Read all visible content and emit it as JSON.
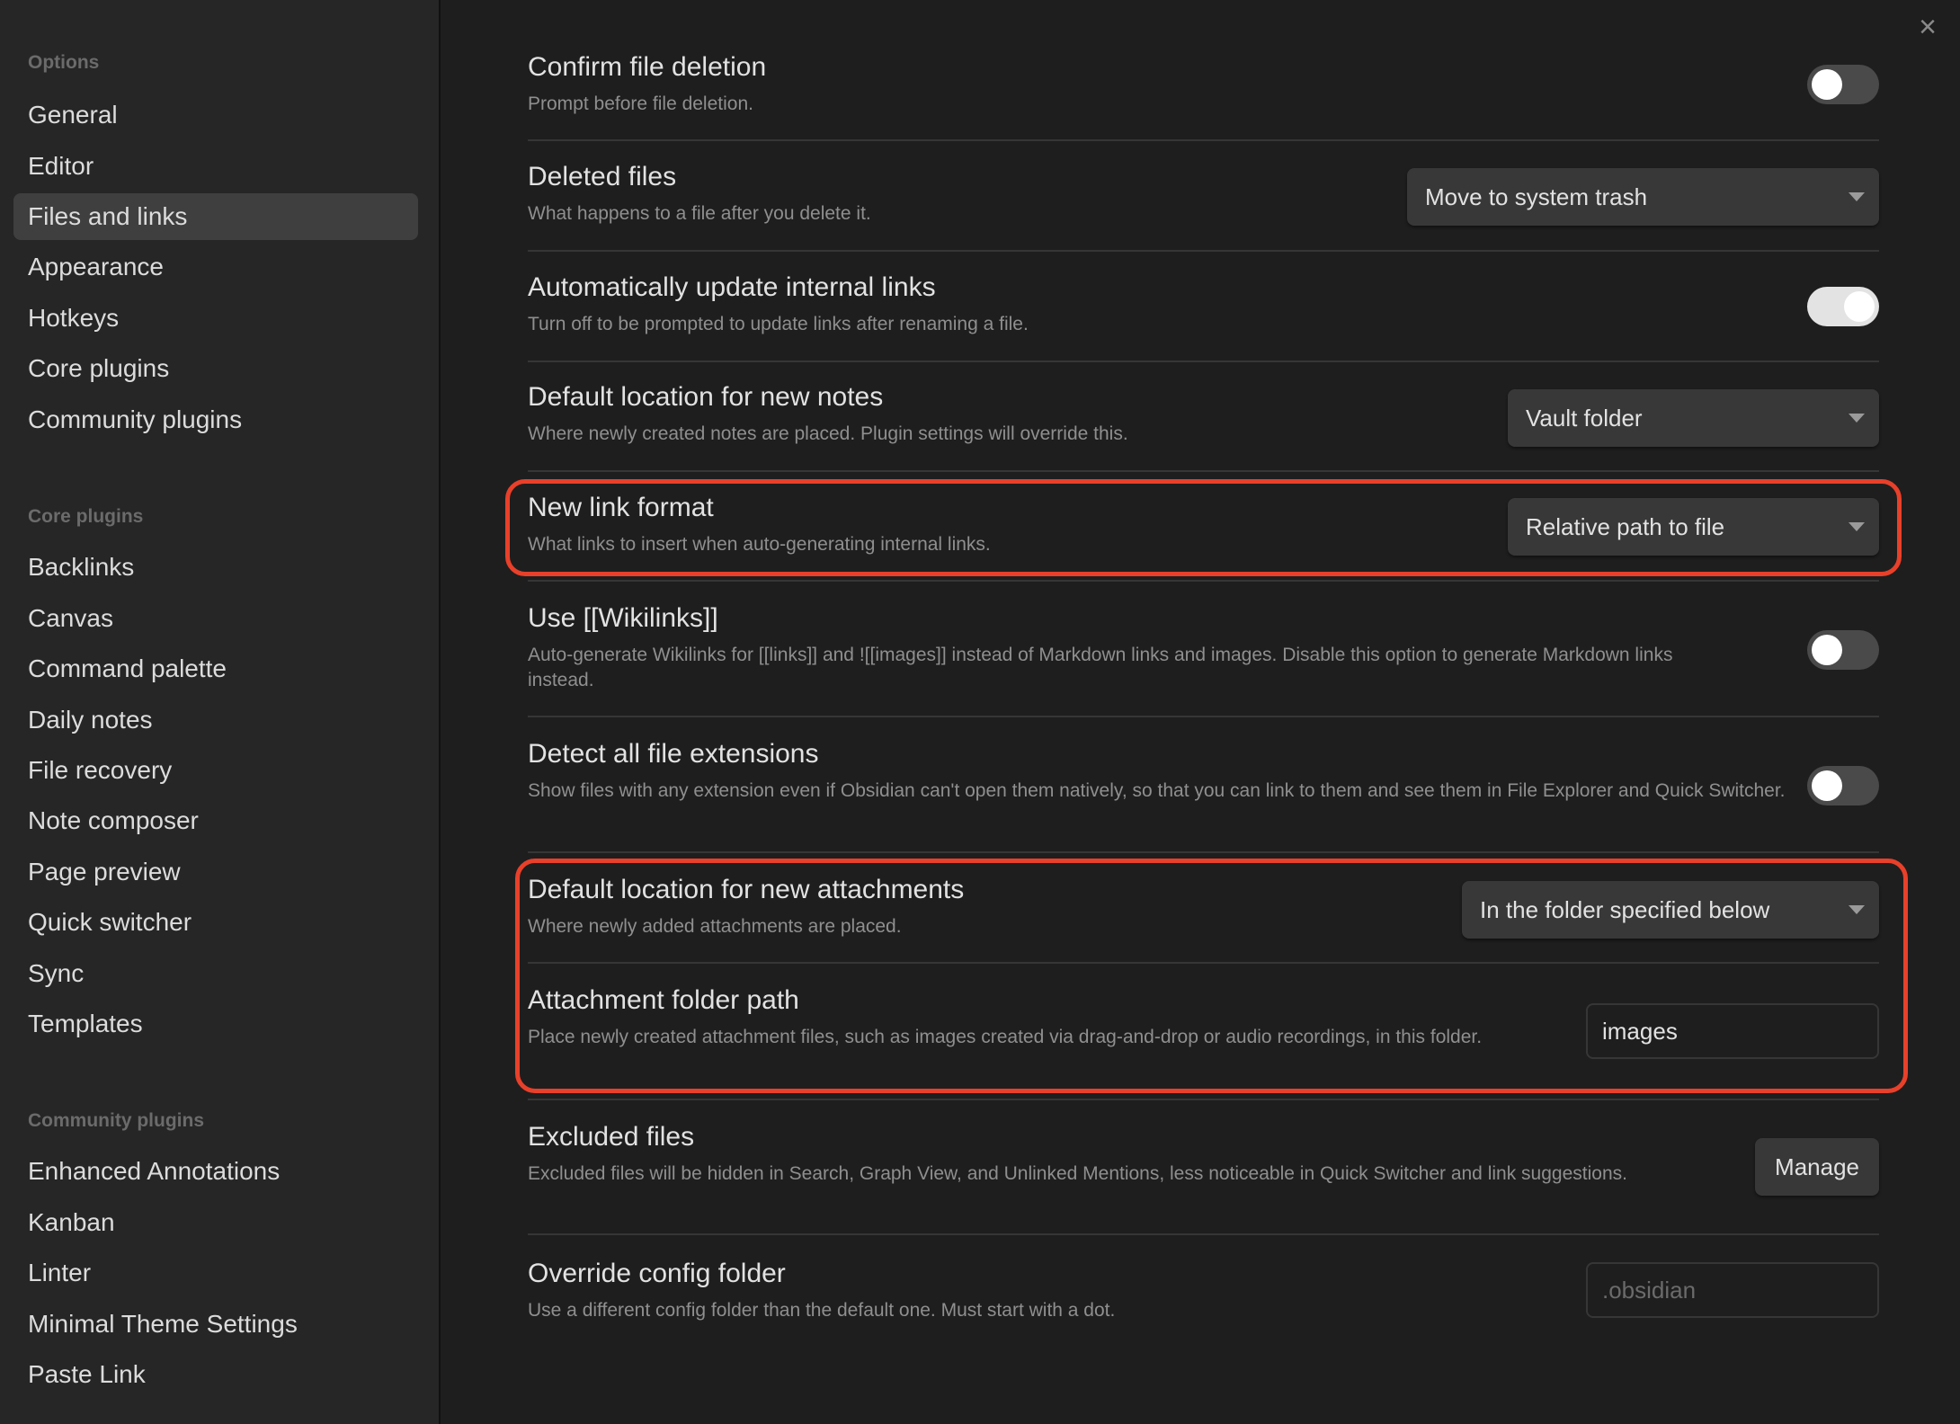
{
  "sidebar": {
    "sections": [
      {
        "heading": "Options",
        "items": [
          "General",
          "Editor",
          "Files and links",
          "Appearance",
          "Hotkeys",
          "Core plugins",
          "Community plugins"
        ]
      },
      {
        "heading": "Core plugins",
        "items": [
          "Backlinks",
          "Canvas",
          "Command palette",
          "Daily notes",
          "File recovery",
          "Note composer",
          "Page preview",
          "Quick switcher",
          "Sync",
          "Templates"
        ]
      },
      {
        "heading": "Community plugins",
        "items": [
          "Enhanced Annotations",
          "Kanban",
          "Linter",
          "Minimal Theme Settings",
          "Paste Link"
        ]
      }
    ],
    "active_item": "Files and links"
  },
  "close_icon": "×",
  "settings": [
    {
      "title": "Confirm file deletion",
      "desc": "Prompt before file deletion.",
      "control": "toggle",
      "value": false
    },
    {
      "title": "Deleted files",
      "desc": "What happens to a file after you delete it.",
      "control": "select",
      "value": "Move to system trash"
    },
    {
      "title": "Automatically update internal links",
      "desc": "Turn off to be prompted to update links after renaming a file.",
      "control": "toggle",
      "value": true
    },
    {
      "title": "Default location for new notes",
      "desc": "Where newly created notes are placed. Plugin settings will override this.",
      "control": "select",
      "value": "Vault folder"
    },
    {
      "title": "New link format",
      "desc": "What links to insert when auto-generating internal links.",
      "control": "select",
      "value": "Relative path to file",
      "highlighted": true
    },
    {
      "title": "Use [[Wikilinks]]",
      "desc": "Auto-generate Wikilinks for [[links]] and ![[images]] instead of Markdown links and images. Disable this option to generate Markdown links instead.",
      "control": "toggle",
      "value": false
    },
    {
      "title": "Detect all file extensions",
      "desc": "Show files with any extension even if Obsidian can't open them natively, so that you can link to them and see them in File Explorer and Quick Switcher.",
      "control": "toggle",
      "value": false
    },
    {
      "title": "Default location for new attachments",
      "desc": "Where newly added attachments are placed.",
      "control": "select",
      "value": "In the folder specified below",
      "highlighted": true
    },
    {
      "title": "Attachment folder path",
      "desc": "Place newly created attachment files, such as images created via drag-and-drop or audio recordings, in this folder.",
      "control": "text",
      "value": "images",
      "highlighted": true
    },
    {
      "title": "Excluded files",
      "desc": "Excluded files will be hidden in Search, Graph View, and Unlinked Mentions, less noticeable in Quick Switcher and link suggestions.",
      "control": "button",
      "value": "Manage"
    },
    {
      "title": "Override config folder",
      "desc": "Use a different config folder than the default one. Must start with a dot.",
      "control": "text",
      "value": "",
      "placeholder": ".obsidian"
    }
  ],
  "highlight_color": "#e8402a"
}
